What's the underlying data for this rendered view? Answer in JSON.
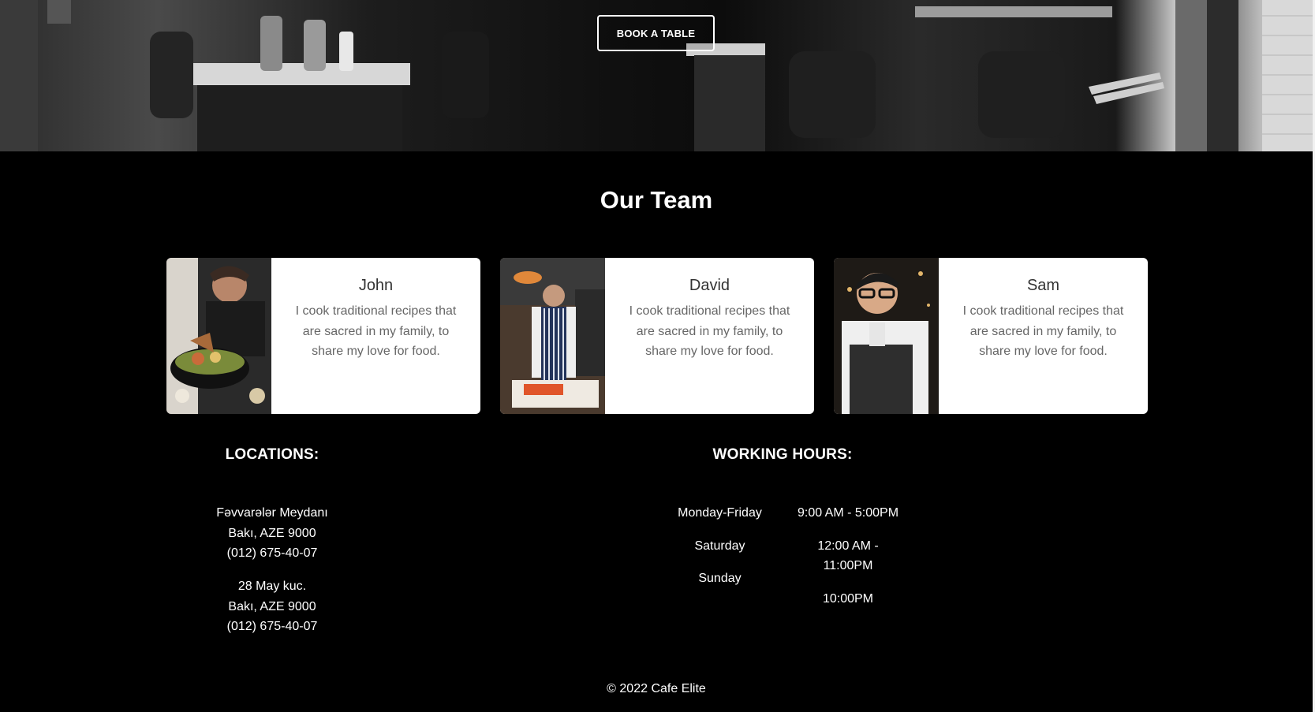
{
  "hero": {
    "cta_label": "BOOK A TABLE"
  },
  "team": {
    "title": "Our Team",
    "members": [
      {
        "name": "John",
        "bio": "I cook traditional recipes that are sacred in my family, to share my love for food."
      },
      {
        "name": "David",
        "bio": "I cook traditional recipes that are sacred in my family, to share my love for food."
      },
      {
        "name": "Sam",
        "bio": "I cook traditional recipes that are sacred in my family, to share my love for food."
      }
    ]
  },
  "locations": {
    "heading": "LOCATIONS:",
    "items": [
      {
        "line1": "Fəvvarələr Meydanı",
        "line2": "Bakı, AZE 9000",
        "phone": "(012) 675-40-07"
      },
      {
        "line1": "28 May kuc.",
        "line2": "Bakı, AZE 9000",
        "phone": "(012) 675-40-07"
      }
    ]
  },
  "hours": {
    "heading": "WORKING HOURS:",
    "days": [
      "Monday-Friday",
      "Saturday",
      "Sunday"
    ],
    "times": [
      "9:00 AM - 5:00PM",
      "12:00 AM - 11:00PM",
      "10:00PM"
    ]
  },
  "footer": {
    "copyright": "© 2022 Cafe Elite"
  },
  "colors": {
    "background": "#000000",
    "card": "#ffffff",
    "name_text": "#333333",
    "bio_text": "#666666"
  }
}
